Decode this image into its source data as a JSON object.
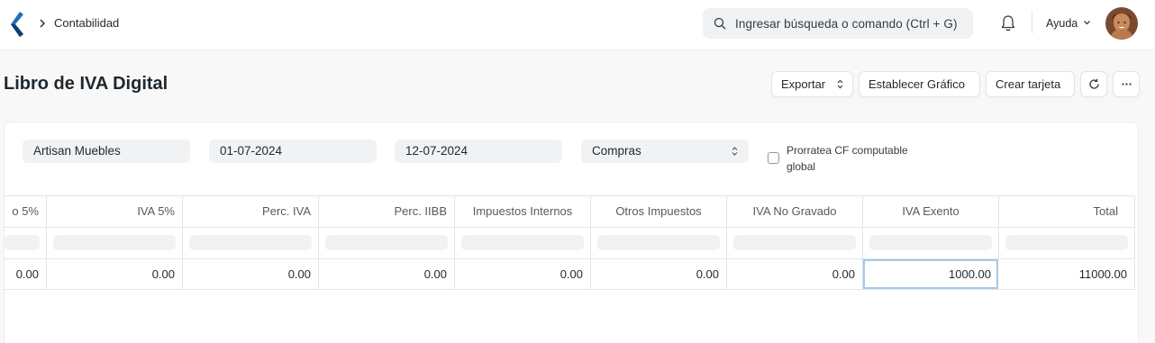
{
  "navbar": {
    "breadcrumb": "Contabilidad",
    "search_placeholder": "Ingresar búsqueda o comando (Ctrl + G)",
    "help_label": "Ayuda",
    "icons": [
      "app-logo-icon",
      "chevron-right-icon",
      "search-icon",
      "bell-icon",
      "chevron-down-icon"
    ]
  },
  "page": {
    "title": "Libro de IVA Digital",
    "actions": {
      "export": "Exportar",
      "set_chart": "Establecer Gráfico",
      "create_card": "Crear tarjeta"
    }
  },
  "filters": {
    "company": "Artisan Muebles",
    "from_date": "01-07-2024",
    "to_date": "12-07-2024",
    "type": "Compras",
    "prorate_label": "Prorratea CF computable global",
    "prorate_checked": false
  },
  "table": {
    "columns": [
      "o 5%",
      "IVA 5%",
      "Perc. IVA",
      "Perc. IIBB",
      "Impuestos Internos",
      "Otros Impuestos",
      "IVA No Gravado",
      "IVA Exento",
      "Total"
    ],
    "rows": [
      [
        "0.00",
        "0.00",
        "0.00",
        "0.00",
        "0.00",
        "0.00",
        "0.00",
        "1000.00",
        "11000.00"
      ]
    ],
    "focused_cell": "IVA Exento"
  },
  "colors": {
    "logo": "#1d6fb8",
    "background": "#f8f8f8",
    "focus_border": "#a7c8e8"
  }
}
